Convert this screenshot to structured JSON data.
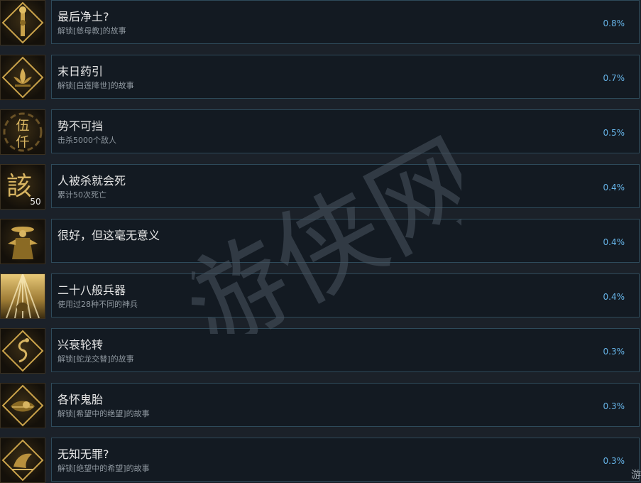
{
  "achievements": [
    {
      "title": "最后净土?",
      "description": "解锁[慈母教]的故事",
      "percent": "0.8%",
      "icon": "golden-scepter-icon"
    },
    {
      "title": "末日药引",
      "description": "解锁[白莲降世]的故事",
      "percent": "0.7%",
      "icon": "lotus-icon"
    },
    {
      "title": "势不可挡",
      "description": "击杀5000个敌人",
      "percent": "0.5%",
      "icon": "wu-qian-glyph-icon"
    },
    {
      "title": "人被杀就会死",
      "description": "累计50次死亡",
      "percent": "0.4%",
      "icon": "gai-50-glyph-icon"
    },
    {
      "title": "很好，但这毫无意义",
      "description": "",
      "percent": "0.4%",
      "icon": "robed-figure-icon"
    },
    {
      "title": "二十八般兵器",
      "description": "使用过28种不同的神兵",
      "percent": "0.4%",
      "icon": "light-rays-hand-icon"
    },
    {
      "title": "兴衰轮转",
      "description": "解锁[蛇龙交替]的故事",
      "percent": "0.3%",
      "icon": "serpent-dragon-icon"
    },
    {
      "title": "各怀鬼胎",
      "description": "解锁[希望中的绝望]的故事",
      "percent": "0.3%",
      "icon": "ghost-fetus-icon"
    },
    {
      "title": "无知无罪?",
      "description": "解锁[绝望中的希望]的故事",
      "percent": "0.3%",
      "icon": "hope-in-despair-icon"
    }
  ],
  "watermark_text": "游侠网",
  "corner_text": "游",
  "colors": {
    "gold": "#c9a24a",
    "percent_blue": "#66b4e8",
    "card_border": "#2e4a5a"
  }
}
